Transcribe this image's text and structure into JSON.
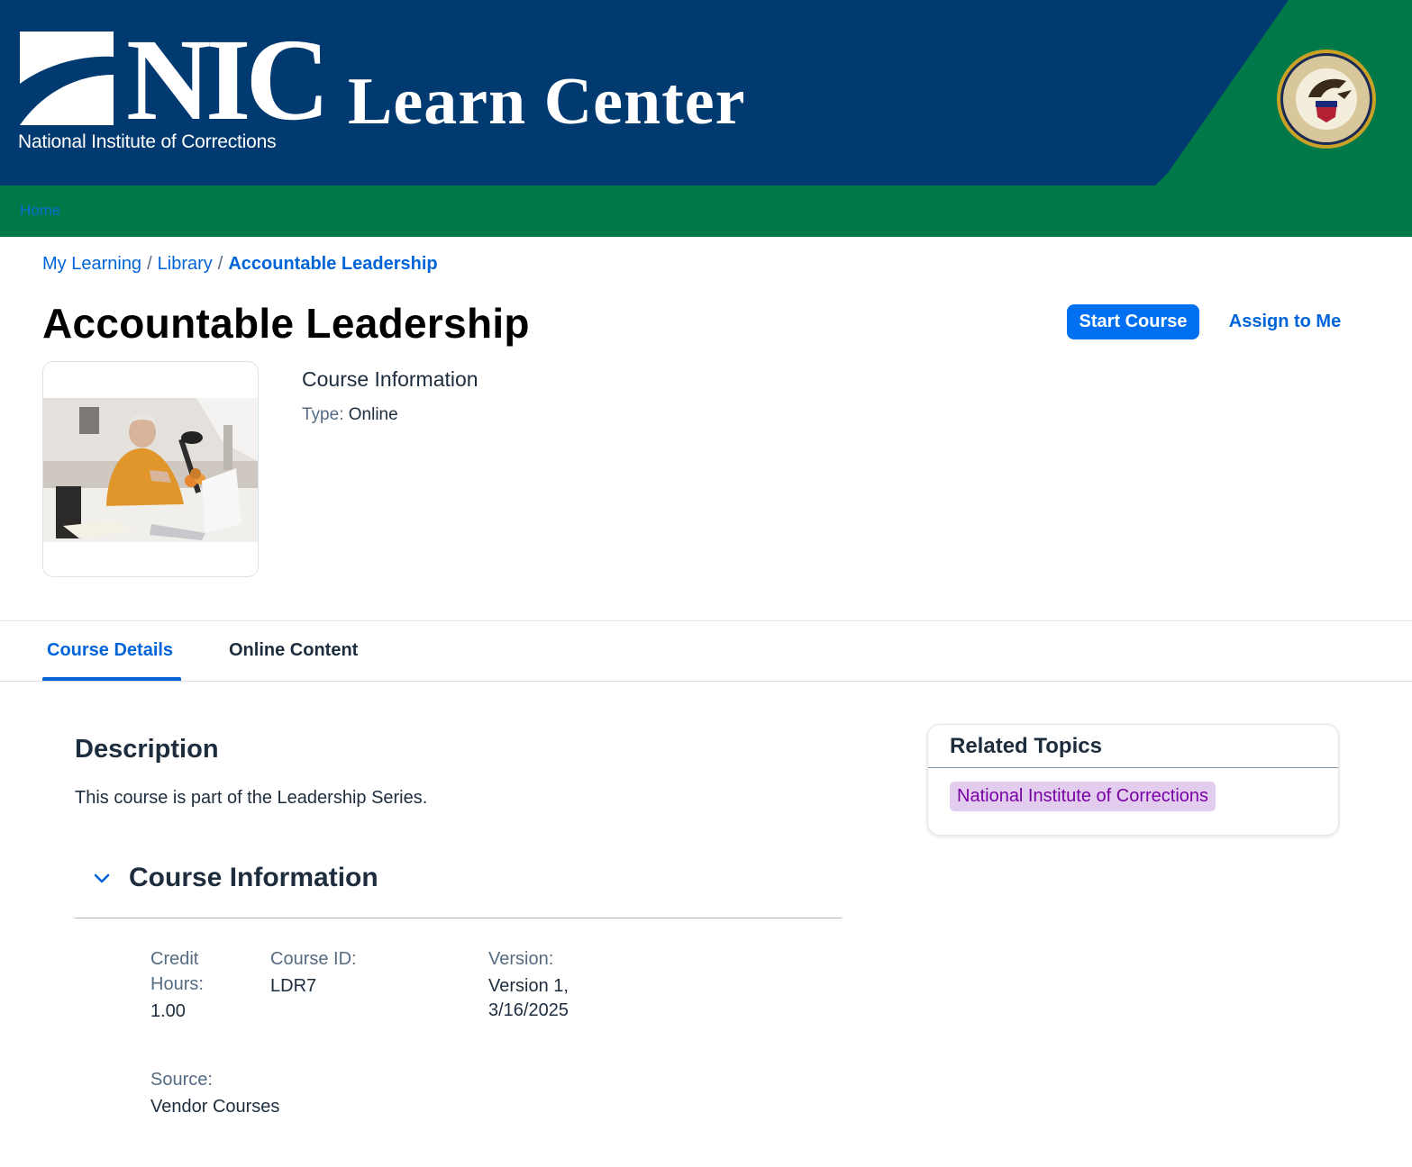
{
  "header": {
    "logo_text": "NIC",
    "logo_subtitle": "National Institute of Corrections",
    "site_title": "Learn Center",
    "seal_icon": "doj-seal-icon",
    "colors": {
      "blue": "#003a70",
      "green": "#007848"
    }
  },
  "nav": {
    "home_label": "Home"
  },
  "breadcrumb": {
    "items": [
      "My Learning",
      "Library",
      "Accountable Leadership"
    ],
    "separator": "/"
  },
  "course": {
    "title": "Accountable Leadership",
    "start_label": "Start Course",
    "assign_label": "Assign to Me",
    "info_heading": "Course Information",
    "type_label": "Type:",
    "type_value": "Online"
  },
  "tabs": [
    {
      "label": "Course Details",
      "active": true
    },
    {
      "label": "Online Content",
      "active": false
    }
  ],
  "description": {
    "title": "Description",
    "text": "This course is part of the Leadership Series."
  },
  "course_info": {
    "section_title": "Course Information",
    "toggle_icon": "chevron-down-icon",
    "credit_label_1": "Credit",
    "credit_label_2": "Hours:",
    "credit_value": "1.00",
    "id_label": "Course ID:",
    "id_value": "LDR7",
    "version_label": "Version:",
    "version_value_1": "Version 1,",
    "version_value_2": "3/16/2025",
    "source_label": "Source:",
    "source_value": "Vendor Courses"
  },
  "related": {
    "title": "Related Topics",
    "topics": [
      "National Institute of Corrections"
    ]
  }
}
